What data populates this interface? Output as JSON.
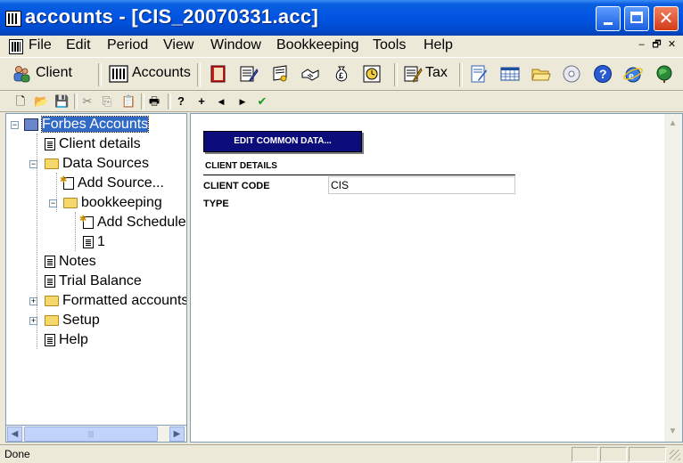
{
  "window": {
    "title": "accounts - [CIS_20070331.acc]",
    "minimize_glyph": "",
    "close_glyph": "✕"
  },
  "menubar": {
    "items": [
      "File",
      "Edit",
      "Period",
      "View",
      "Window",
      "Bookkeeping",
      "Tools",
      "Help"
    ],
    "mdi_minimize": "–",
    "mdi_restore": "🗗",
    "mdi_close": "✕"
  },
  "toolbar": {
    "client_label": "Client",
    "accounts_label": "Accounts",
    "tax_label": "Tax"
  },
  "toolbar2": {
    "icons": [
      "new-icon",
      "open-icon",
      "save-icon",
      "cut-icon",
      "copy-icon",
      "paste-icon",
      "print-icon",
      "help-pointer-icon",
      "add-icon",
      "back-icon",
      "forward-icon",
      "spellcheck-icon"
    ],
    "glyphs": {
      "new": "🗋",
      "open": "📂",
      "save": "💾",
      "cut": "✂",
      "copy": "⎘",
      "paste": "📋",
      "print": "🖶",
      "help": "?",
      "add": "+",
      "back": "◀",
      "forward": "▶",
      "spell": "✔"
    }
  },
  "tree": {
    "root": "Forbes Accounts",
    "items": {
      "client_details": "Client details",
      "data_sources": "Data Sources",
      "add_source": "Add Source...",
      "bookkeeping": "bookkeeping",
      "add_schedule": "Add Schedule",
      "schedule_1": "1",
      "notes": "Notes",
      "trial_balance": "Trial Balance",
      "formatted_accounts": "Formatted accounts",
      "setup": "Setup",
      "help": "Help"
    },
    "expand_minus": "−",
    "expand_plus": "+"
  },
  "hscroll": {
    "left_glyph": "◀",
    "right_glyph": "▶",
    "thumb_grip": "|||"
  },
  "content": {
    "edit_button": "EDIT COMMON DATA...",
    "section_title": "CLIENT DETAILS",
    "fields": {
      "client_code_label": "CLIENT CODE",
      "client_code_value": "CIS",
      "type_label": "TYPE"
    },
    "vscroll_up": "▲",
    "vscroll_down": "▼"
  },
  "status": {
    "text": "Done"
  },
  "colors": {
    "title_blue": "#0054e3",
    "selection": "#316ac5",
    "edit_button_bg": "#0c0c7a",
    "chrome": "#ece9d8"
  }
}
